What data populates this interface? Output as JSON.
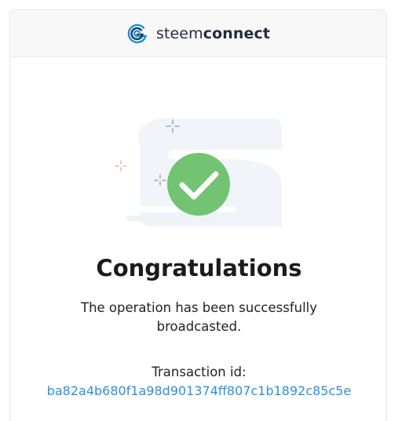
{
  "header": {
    "brand_regular": "steem",
    "brand_bold": "connect",
    "logo_icon": "steemconnect-logo-icon"
  },
  "illustration": {
    "icon": "success-checkmark-icon",
    "check_color": "#72c472",
    "background_shape_color": "#f1f5fa",
    "sparkle_colors": [
      "#8a96a8",
      "#f2a48a"
    ]
  },
  "main": {
    "title": "Congratulations",
    "message": "The operation has been successfully broadcasted.",
    "transaction_label": "Transaction id:",
    "transaction_id": "ba82a4b680f1a98d901374ff807c1b1892c85c5e"
  },
  "colors": {
    "link": "#2d8fe0",
    "brand_blue": "#1a8fe0"
  }
}
